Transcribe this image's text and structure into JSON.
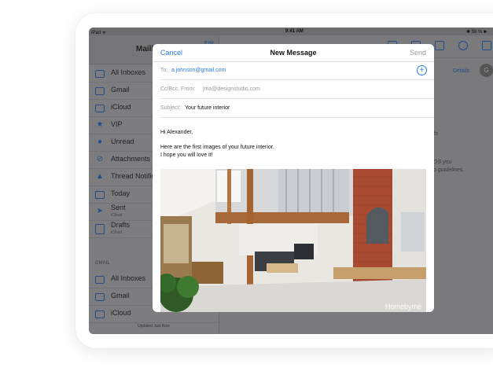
{
  "status_bar": {
    "left": "iPad ᯤ",
    "time": "9:41 AM",
    "battery": "✱ 58 % ■"
  },
  "sidebar": {
    "title": "Mailboxes",
    "edit": "Edit",
    "items": [
      {
        "label": "All Inboxes",
        "icon": "inbox-tray-icon"
      },
      {
        "label": "Gmail",
        "icon": "inbox-tray-icon"
      },
      {
        "label": "iCloud",
        "icon": "inbox-tray-icon"
      },
      {
        "label": "VIP",
        "icon": "star-icon"
      },
      {
        "label": "Unread",
        "icon": "dot-icon"
      },
      {
        "label": "Attachments",
        "icon": "paperclip-icon"
      },
      {
        "label": "Thread Notifications",
        "icon": "bell-icon"
      },
      {
        "label": "Today",
        "icon": "calendar-icon"
      },
      {
        "label": "Sent",
        "sub": "iCloud",
        "icon": "paper-plane-icon"
      },
      {
        "label": "Drafts",
        "sub": "iCloud",
        "icon": "document-icon"
      }
    ],
    "section": "GMAIL",
    "section_items": [
      {
        "label": "All Inboxes",
        "icon": "inbox-tray-icon"
      },
      {
        "label": "Gmail",
        "icon": "inbox-tray-icon"
      },
      {
        "label": "iCloud",
        "icon": "inbox-tray-icon"
      }
    ],
    "footer": "Updated Just Now"
  },
  "right_pane": {
    "details": "Details",
    "avatar": "G",
    "ghost_1": "to",
    "ghost_2": "OS you",
    "ghost_3": "o guidelines."
  },
  "compose": {
    "cancel": "Cancel",
    "title": "New Message",
    "send": "Send",
    "to_label": "To:",
    "to_value": "a.johnson@gmail.com",
    "cc_label": "Cc/Bcc, From:",
    "cc_value": "jma@designstudio.com",
    "subject_label": "Subject:",
    "subject_value": "Your future interior",
    "greeting": "Hi Alexander,",
    "line1": "Here are the first images of your future interior.",
    "line2": "I hope you will love it!",
    "watermark": "Homebyme"
  }
}
